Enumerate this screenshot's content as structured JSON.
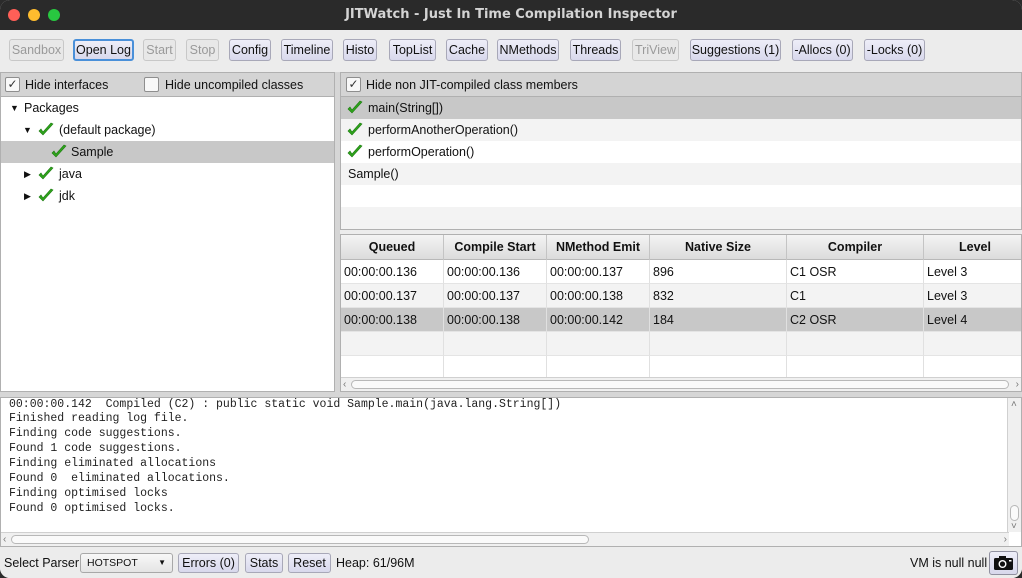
{
  "window": {
    "title": "JITWatch - Just In Time Compilation Inspector"
  },
  "toolbar": {
    "buttons": [
      {
        "label": "Sandbox",
        "enabled": false
      },
      {
        "label": "Open Log",
        "enabled": true,
        "focused": true
      },
      {
        "label": "Start",
        "enabled": false
      },
      {
        "label": "Stop",
        "enabled": false
      },
      {
        "label": "Config",
        "enabled": true
      },
      {
        "label": "Timeline",
        "enabled": true
      },
      {
        "label": "Histo",
        "enabled": true
      },
      {
        "label": "TopList",
        "enabled": true
      },
      {
        "label": "Cache",
        "enabled": true
      },
      {
        "label": "NMethods",
        "enabled": true
      },
      {
        "label": "Threads",
        "enabled": true
      },
      {
        "label": "TriView",
        "enabled": false
      },
      {
        "label": "Suggestions (1)",
        "enabled": true
      },
      {
        "label": "-Allocs (0)",
        "enabled": true
      },
      {
        "label": "-Locks (0)",
        "enabled": true
      }
    ]
  },
  "class_tree": {
    "hide_interfaces": {
      "label": "Hide interfaces",
      "checked": true
    },
    "hide_uncompiled": {
      "label": "Hide uncompiled classes",
      "checked": false
    },
    "nodes": [
      {
        "label": "Packages",
        "expanded": true,
        "compiled": false,
        "depth": 0
      },
      {
        "label": "(default package)",
        "expanded": true,
        "compiled": true,
        "depth": 1
      },
      {
        "label": "Sample",
        "compiled": true,
        "depth": 2,
        "selected": true
      },
      {
        "label": "java",
        "expanded": false,
        "compiled": true,
        "depth": 1
      },
      {
        "label": "jdk",
        "expanded": false,
        "compiled": true,
        "depth": 1
      }
    ]
  },
  "members": {
    "hide_non_jit": {
      "label": "Hide non JIT-compiled class members",
      "checked": true
    },
    "items": [
      {
        "label": "main(String[])",
        "compiled": true,
        "selected": true
      },
      {
        "label": "performAnotherOperation()",
        "compiled": true
      },
      {
        "label": "performOperation()",
        "compiled": true
      },
      {
        "label": "Sample()",
        "compiled": false
      }
    ]
  },
  "compilations": {
    "columns": [
      "Queued",
      "Compile Start",
      "NMethod Emit",
      "Native Size",
      "Compiler",
      "Level"
    ],
    "rows": [
      [
        "00:00:00.136",
        "00:00:00.136",
        "00:00:00.137",
        "896",
        "C1 OSR",
        "Level 3"
      ],
      [
        "00:00:00.137",
        "00:00:00.137",
        "00:00:00.138",
        "832",
        "C1",
        "Level 3"
      ],
      [
        "00:00:00.138",
        "00:00:00.138",
        "00:00:00.142",
        "184",
        "C2 OSR",
        "Level 4"
      ]
    ],
    "selected_row": 2
  },
  "log": {
    "lines": [
      "00:00:00.142  Compiled (C2) : public static void Sample.main(java.lang.String[])",
      "Finished reading log file.",
      "Finding code suggestions.",
      "Found 1 code suggestions.",
      "Finding eliminated allocations",
      "Found 0  eliminated allocations.",
      "Finding optimised locks",
      "Found 0 optimised locks."
    ]
  },
  "statusbar": {
    "parser_label": "Select Parser",
    "parser_value": "HOTSPOT",
    "errors_label": "Errors (0)",
    "stats_label": "Stats",
    "reset_label": "Reset",
    "heap": "Heap: 61/96M",
    "vm_status": "VM is null null",
    "camera_icon": "camera-icon"
  }
}
